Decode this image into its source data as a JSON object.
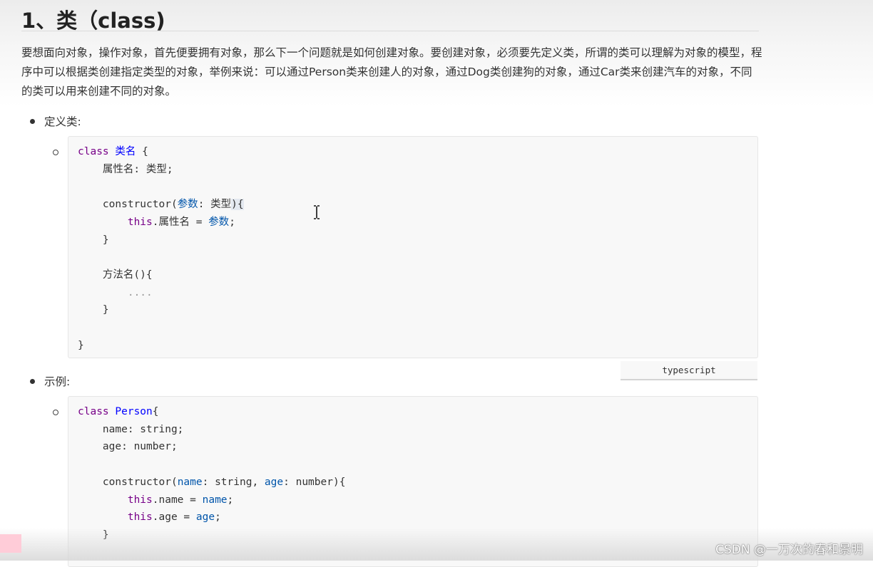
{
  "heading": "1、类（class)",
  "intro": "要想面向对象，操作对象，首先便要拥有对象，那么下一个问题就是如何创建对象。要创建对象，必须要先定义类，所谓的类可以理解为对象的模型，程序中可以根据类创建指定类型的对象，举例来说：可以通过Person类来创建人的对象，通过Dog类创建狗的对象，通过Car类来创建汽车的对象，不同的类可以用来创建不同的对象。",
  "section_define": {
    "label": "定义类:",
    "code": {
      "l1_kw": "class",
      "l1_name": "类名",
      "l1_brace": "{",
      "l2": "属性名: 类型;",
      "l4_fn": "constructor",
      "l4_param": "参数",
      "l4_type": ": 类型",
      "l4_close": "){",
      "l5_this": "this",
      "l5_prop": ".属性名 = ",
      "l5_val": "参数",
      "l6": "}",
      "l8": "方法名(){",
      "l9": "....",
      "l10": "}",
      "l12": "}"
    },
    "language": "typescript"
  },
  "section_example": {
    "label": "示例:",
    "code": {
      "l1_kw": "class",
      "l1_name": "Person",
      "l1_brace": "{",
      "l2": "name: string;",
      "l3": "age: number;",
      "l5_fn": "constructor(",
      "l5_p1": "name",
      "l5_mid": ": string, ",
      "l5_p2": "age",
      "l5_end": ": number){",
      "l6_this": "this",
      "l6_prop": ".name = ",
      "l6_val": "name",
      "l7_this": "this",
      "l7_prop": ".age = ",
      "l7_val": "age",
      "l8": "}"
    }
  },
  "watermark": "CSDN @一万次的春和景明",
  "colors": {
    "keyword": "#770088",
    "definition": "#0000ff",
    "variable": "#0055aa",
    "code_bg": "#f8f8f8",
    "sticker": "#ffccd8"
  }
}
